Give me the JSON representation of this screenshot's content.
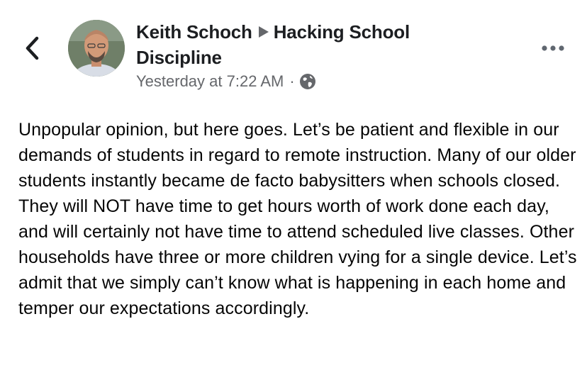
{
  "header": {
    "author": "Keith Schoch",
    "group_line1": "Hacking School",
    "group_line2": "Discipline",
    "timestamp": "Yesterday at 7:22 AM",
    "separator": "·",
    "privacy_icon": "globe-icon"
  },
  "icons": {
    "back": "chevron-left-icon",
    "more": "more-horizontal-icon",
    "arrow": "triangle-right-icon"
  },
  "post": {
    "text": "Unpopular opinion, but here goes. Let’s be patient and flexible in our demands of students in regard to remote instruction. Many of our older students instantly became de facto babysitters when schools closed. They will NOT have time to get hours worth of work done each day, and will certainly not have time to attend scheduled live classes. Other households have three or more children vying for a single device. Let’s admit that we simply can’t know what is happening in each home and temper our expectations accordingly."
  },
  "colors": {
    "text_primary": "#1c1e21",
    "text_secondary": "#65676b",
    "icon": "#1c1e21"
  }
}
